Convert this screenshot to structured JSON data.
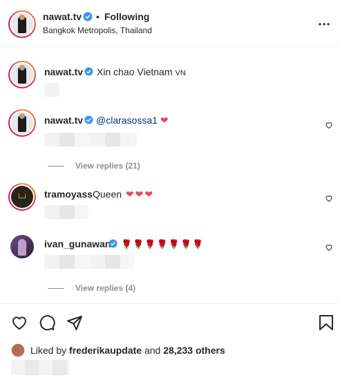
{
  "post_header": {
    "username": "nawat.tv",
    "separator": "•",
    "follow_status": "Following",
    "location": "Bangkok Metropolis, Thailand"
  },
  "comments": [
    {
      "username": "nawat.tv",
      "verified": true,
      "text": "Xin chao Vietnam",
      "flag_text": "VN",
      "avatar": "suit-man"
    },
    {
      "username": "nawat.tv",
      "verified": true,
      "mention": "@clarasossa1",
      "emoji": "❤",
      "avatar": "suit-man",
      "replies_label": "View replies (21)"
    },
    {
      "username": "tramoyass",
      "verified": false,
      "text": "Queen",
      "emoji": [
        "❤",
        "❤",
        "❤"
      ],
      "avatar": "crown-logo"
    },
    {
      "username": "ivan_gunawan",
      "verified": true,
      "emoji": [
        "🌹",
        "🌹",
        "🌹",
        "🌹",
        "🌹",
        "🌹",
        "🌹"
      ],
      "avatar": "purple-portrait",
      "replies_label": "View replies (4)"
    }
  ],
  "actions": {
    "icons": [
      "heart-icon",
      "comment-icon",
      "share-icon",
      "bookmark-icon"
    ],
    "liked_by_prefix": "Liked by",
    "liked_by_user": "frederikaupdate",
    "liked_by_and": "and",
    "liked_by_count": "28,233 others"
  },
  "colors": {
    "verified": "#3897f0",
    "heart": "#ed4956",
    "mention": "#00376b",
    "muted": "#8e8e8e"
  }
}
